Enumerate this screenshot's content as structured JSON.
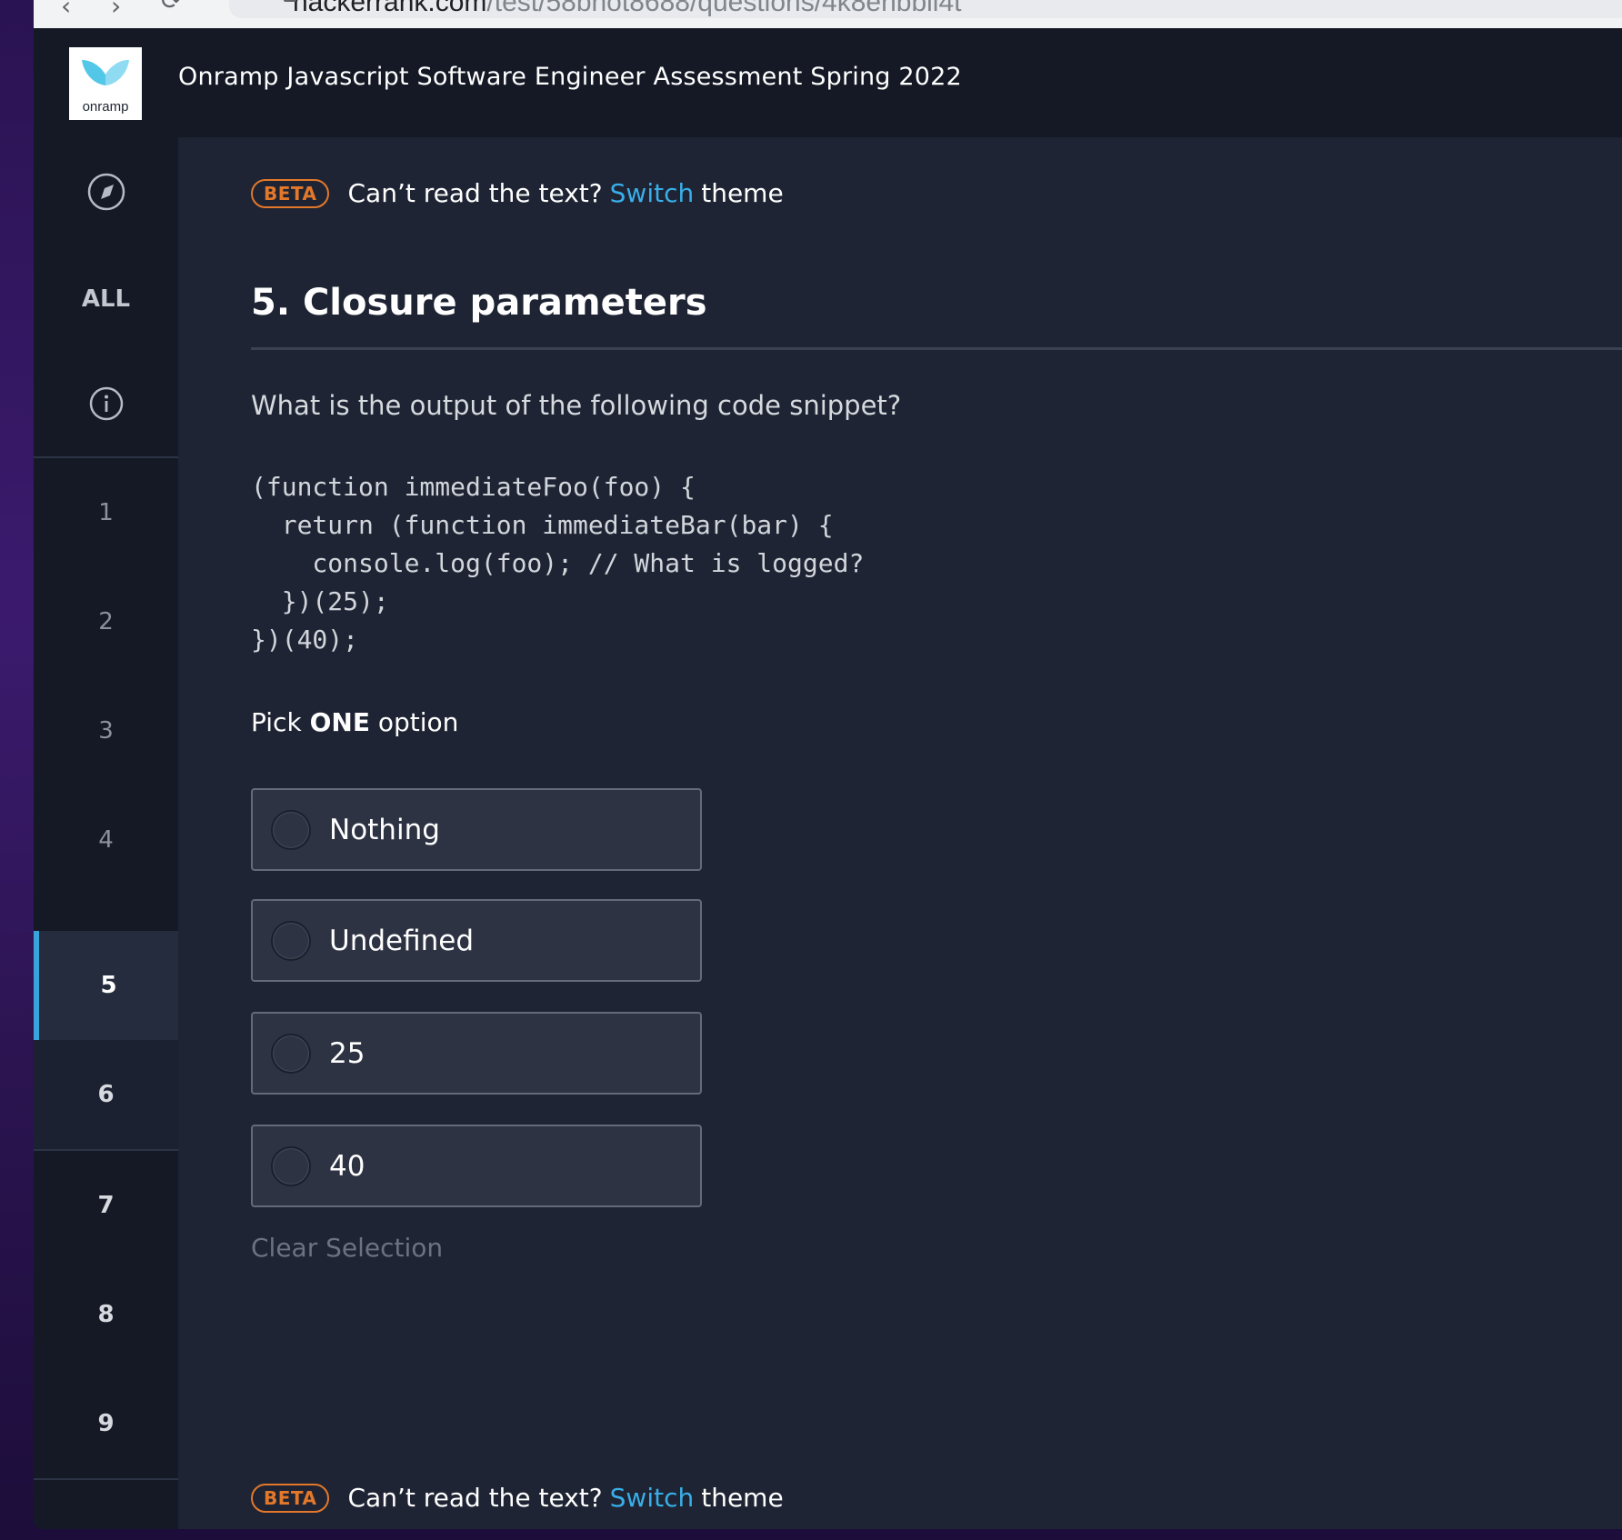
{
  "browser": {
    "back_icon": "‹",
    "forward_icon": "›",
    "url_host": "hackerrank.com",
    "url_path": "/test/58bnot8688/questions/4k8enbbii4t"
  },
  "header": {
    "logo_text": "onramp",
    "title": "Onramp Javascript Software Engineer Assessment Spring 2022"
  },
  "sidebar": {
    "all_label": "ALL",
    "questions": [
      "1",
      "2",
      "3",
      "4",
      "5",
      "6",
      "7",
      "8",
      "9"
    ],
    "active_question": "5"
  },
  "beta_banner": {
    "badge": "BETA",
    "text_before": "Can’t read the text?",
    "link": "Switch",
    "text_after": "theme"
  },
  "question": {
    "title": "5. Closure parameters",
    "prompt": "What is the output of the following code snippet?",
    "code": "(function immediateFoo(foo) {\n  return (function immediateBar(bar) {\n    console.log(foo); // What is logged?\n  })(25);\n})(40);",
    "pick_prefix": "Pick",
    "pick_emphasis": "ONE",
    "pick_suffix": "option",
    "options": [
      "Nothing",
      "Undefined",
      "25",
      "40"
    ],
    "clear_label": "Clear Selection"
  },
  "colors": {
    "accent": "#39aee8",
    "beta": "#e3782b",
    "active_marker": "#39a3dc"
  },
  "icons": {
    "sidebar_top": "compass-icon",
    "sidebar_info": "info-icon"
  }
}
